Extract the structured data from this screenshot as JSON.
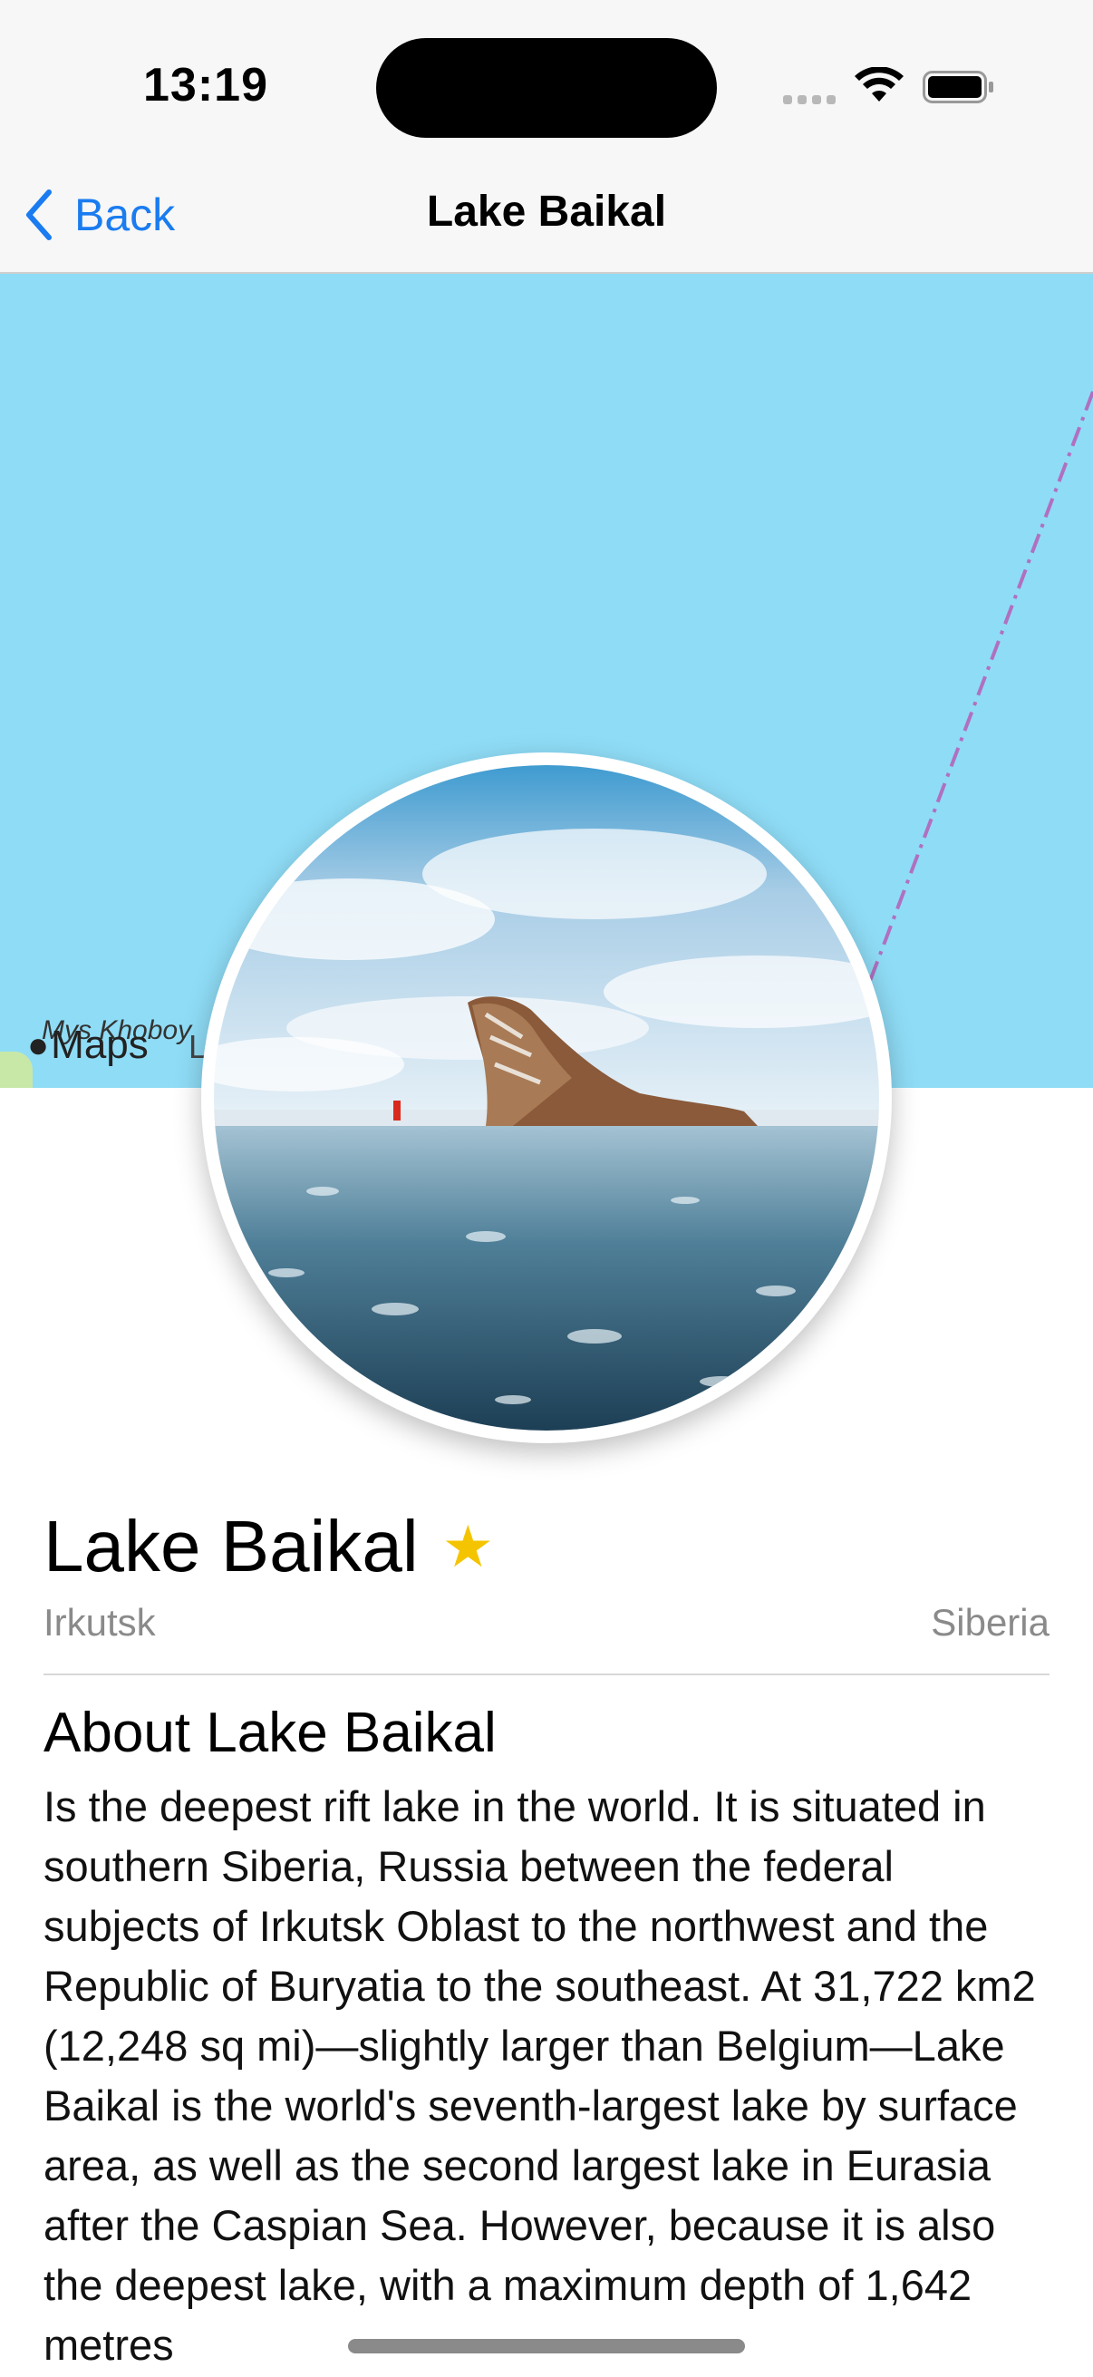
{
  "status": {
    "time": "13:19"
  },
  "nav": {
    "back_label": "Back",
    "title": "Lake Baikal"
  },
  "map": {
    "place_label": "Mys Khoboy",
    "brand": "Maps",
    "legal": "L"
  },
  "landmark": {
    "name": "Lake Baikal",
    "park": "Irkutsk",
    "state": "Siberia",
    "favorite": true,
    "about_title": "About Lake Baikal",
    "description": "Is the deepest rift lake in the world. It is situated in southern Siberia, Russia between the federal subjects of Irkutsk Oblast to the northwest and the Republic of Buryatia to the southeast. At 31,722 km2 (12,248 sq mi)—slightly larger than Belgium—Lake Baikal is the world's seventh-largest lake by surface area, as well as the second largest lake in Eurasia after the Caspian Sea. However, because it is also the deepest lake, with a maximum depth of 1,642 metres"
  },
  "colors": {
    "accent": "#1a7cf0",
    "star": "#f5c400",
    "map_water": "#8fdcf6"
  },
  "icons": {
    "back": "chevron-left-icon",
    "favorite": "star-fill-icon",
    "wifi": "wifi-icon",
    "battery": "battery-icon"
  }
}
